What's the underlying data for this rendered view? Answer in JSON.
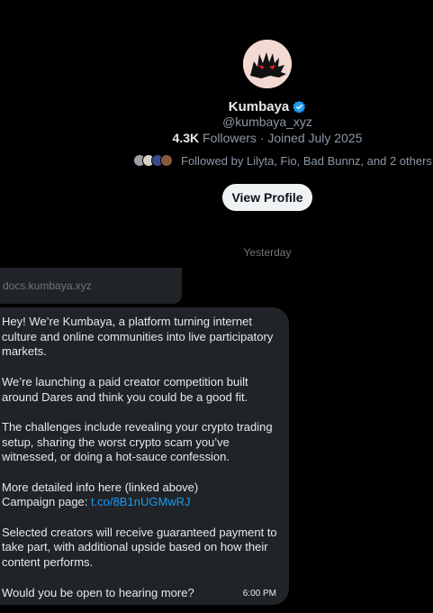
{
  "profile": {
    "name": "Kumbaya",
    "handle": "@kumbaya_xyz",
    "followers_count": "4.3K",
    "followers_label": "Followers",
    "joined": "· Joined July 2025",
    "followed_by": "Followed by Lilyta, Fio, Bad Bunnz, and 2 others",
    "view_profile_label": "View Profile",
    "verified_color": "#1d9bf0"
  },
  "conversation": {
    "date_separator": "Yesterday",
    "link_card": {
      "domain": "docs.kumbaya.xyz"
    },
    "message": {
      "p1": "Hey! We’re Kumbaya, a platform turning internet culture and online communities into live participatory markets.",
      "p2": "We’re launching a paid creator competition built around Dares and think you could be a good fit.",
      "p3": "The challenges include revealing your crypto trading setup, sharing the worst crypto scam you’ve witnessed, or doing a hot-sauce confession.",
      "p4_line1": "More detailed info here (linked above)",
      "p4_label": "Campaign page: ",
      "p4_link": "t.co/8B1nUGMwRJ",
      "p5": "Selected creators will receive guaranteed payment to take part, with additional upside based on how their content performs.",
      "p6": "Would you be open to hearing more?",
      "time": "6:00 PM"
    }
  },
  "colors": {
    "background": "#000000",
    "bubble": "#202327",
    "link": "#1d9bf0",
    "muted": "#8b98a5"
  }
}
